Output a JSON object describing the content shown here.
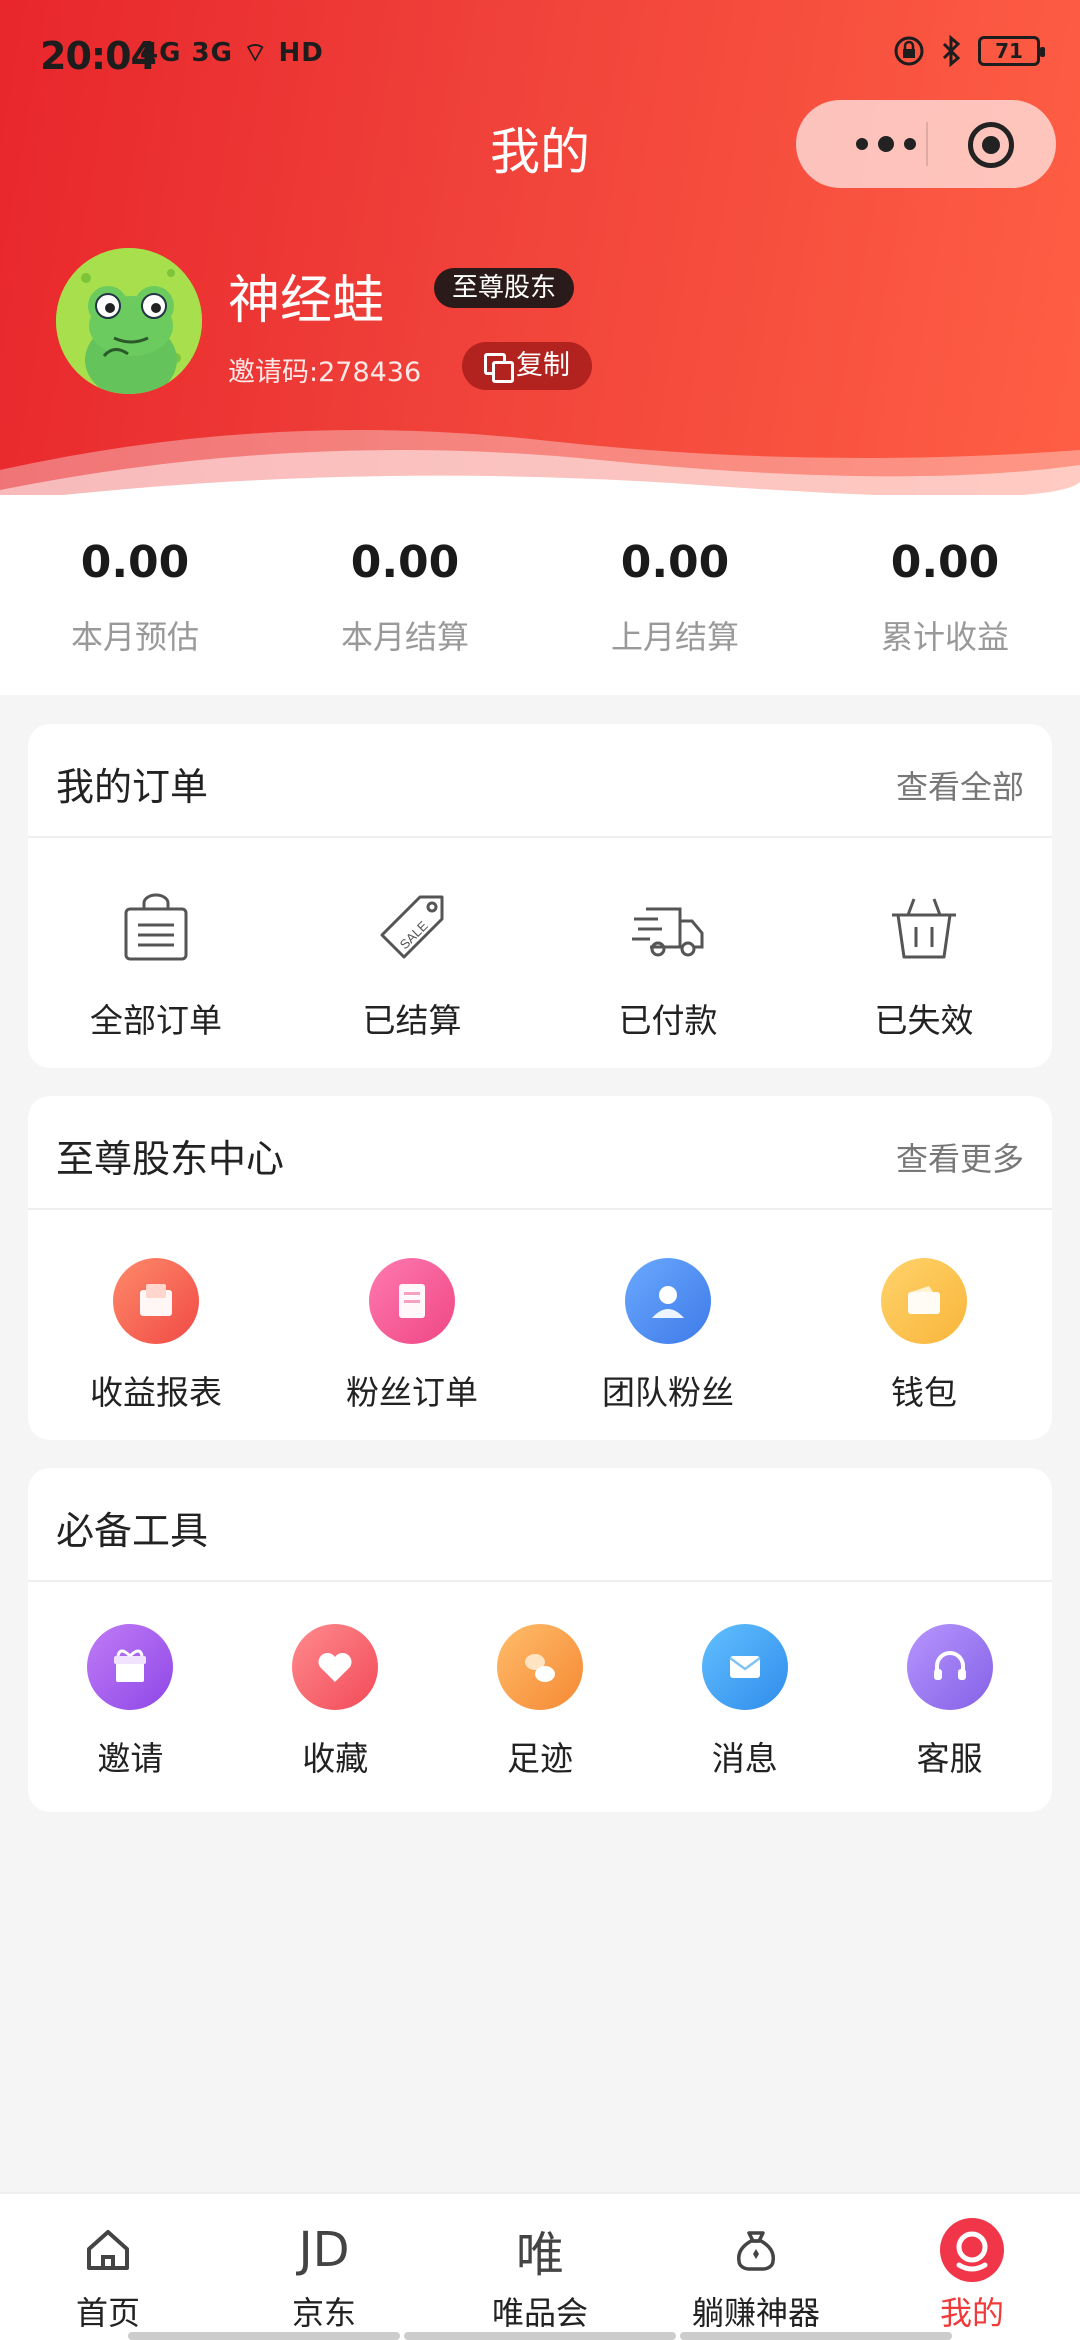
{
  "status_bar": {
    "time": "20:04",
    "signal": "4G 3G ⌔ HD",
    "battery": "71"
  },
  "header": {
    "title": "我的"
  },
  "profile": {
    "username": "神经蛙",
    "vip_badge": "至尊股东",
    "invite_code": "邀请码:278436",
    "copy_label": "复制"
  },
  "stats": [
    {
      "value": "0.00",
      "label": "本月预估"
    },
    {
      "value": "0.00",
      "label": "本月结算"
    },
    {
      "value": "0.00",
      "label": "上月结算"
    },
    {
      "value": "0.00",
      "label": "累计收益"
    }
  ],
  "orders": {
    "title": "我的订单",
    "more": "查看全部",
    "items": [
      {
        "label": "全部订单",
        "icon": "shopping-bag-icon"
      },
      {
        "label": "已结算",
        "icon": "sale-tag-icon"
      },
      {
        "label": "已付款",
        "icon": "delivery-truck-icon"
      },
      {
        "label": "已失效",
        "icon": "basket-icon"
      }
    ]
  },
  "vip_center": {
    "title": "至尊股东中心",
    "more": "查看更多",
    "items": [
      {
        "label": "收益报表",
        "icon": "report-icon",
        "color": "#f65a4c"
      },
      {
        "label": "粉丝订单",
        "icon": "fan-orders-icon",
        "color": "#f55392"
      },
      {
        "label": "团队粉丝",
        "icon": "team-icon",
        "color": "#4f8ff5"
      },
      {
        "label": "钱包",
        "icon": "wallet-icon",
        "color": "#fbc045"
      }
    ]
  },
  "tools": {
    "title": "必备工具",
    "items": [
      {
        "label": "邀请",
        "icon": "gift-icon",
        "color": "#a25cf0"
      },
      {
        "label": "收藏",
        "icon": "heart-icon",
        "color": "#f7606b"
      },
      {
        "label": "足迹",
        "icon": "footprint-icon",
        "color": "#f9a045"
      },
      {
        "label": "消息",
        "icon": "message-icon",
        "color": "#3fa2f2"
      },
      {
        "label": "客服",
        "icon": "headset-icon",
        "color": "#9a79ec"
      }
    ]
  },
  "tabbar": [
    {
      "label": "首页",
      "icon": "home-icon"
    },
    {
      "label": "京东",
      "icon_text": "JD"
    },
    {
      "label": "唯品会",
      "icon_text": "唯"
    },
    {
      "label": "躺赚神器",
      "icon": "money-bag-icon"
    },
    {
      "label": "我的",
      "icon": "profile-icon",
      "active": true
    }
  ]
}
